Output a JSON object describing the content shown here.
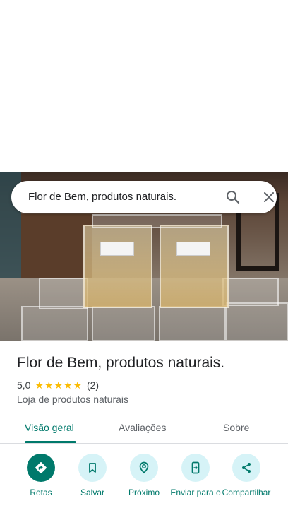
{
  "search": {
    "query": "Flor de Bem, produtos naturais."
  },
  "place": {
    "name": "Flor de Bem, produtos naturais.",
    "rating_value": "5,0",
    "rating_stars": 5,
    "review_count": "(2)",
    "category": "Loja de produtos naturais"
  },
  "tabs": [
    {
      "label": "Visão geral",
      "active": true
    },
    {
      "label": "Avaliações",
      "active": false
    },
    {
      "label": "Sobre",
      "active": false
    }
  ],
  "actions": [
    {
      "label": "Rotas",
      "icon": "directions-icon"
    },
    {
      "label": "Salvar",
      "icon": "bookmark-icon"
    },
    {
      "label": "Próximo",
      "icon": "nearby-icon"
    },
    {
      "label": "Enviar para o",
      "icon": "send-to-phone-icon"
    },
    {
      "label": "Compartilhar",
      "icon": "share-icon"
    }
  ],
  "colors": {
    "accent": "#00796b",
    "action_bg": "#d6f3f7",
    "star": "#fbbc04"
  }
}
